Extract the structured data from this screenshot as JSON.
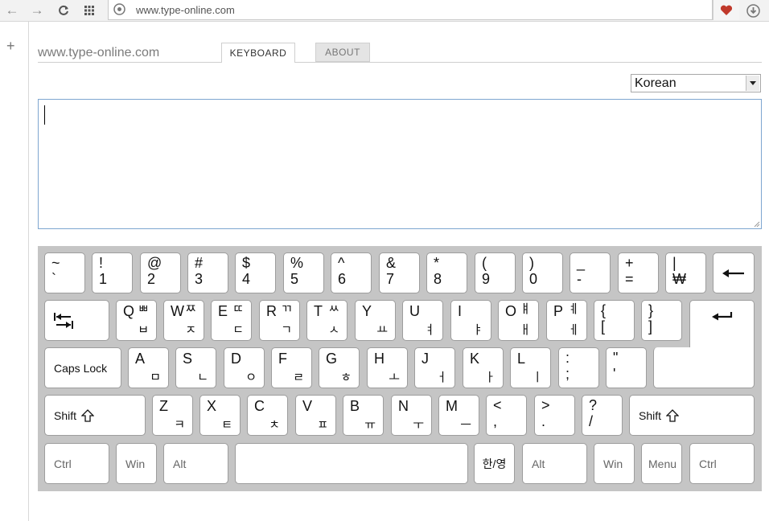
{
  "browser": {
    "url": "www.type-online.com"
  },
  "site": {
    "title": "www.type-online.com"
  },
  "tabs": {
    "keyboard": "KEYBOARD",
    "about": "ABOUT"
  },
  "language": {
    "selected": "Korean"
  },
  "editor": {
    "value": ""
  },
  "keyboard": {
    "row1": [
      {
        "upper": "~",
        "lower": "`"
      },
      {
        "upper": "!",
        "lower": "1"
      },
      {
        "upper": "@",
        "lower": "2"
      },
      {
        "upper": "#",
        "lower": "3"
      },
      {
        "upper": "$",
        "lower": "4"
      },
      {
        "upper": "%",
        "lower": "5"
      },
      {
        "upper": "^",
        "lower": "6"
      },
      {
        "upper": "&",
        "lower": "7"
      },
      {
        "upper": "*",
        "lower": "8"
      },
      {
        "upper": "(",
        "lower": "9"
      },
      {
        "upper": ")",
        "lower": "0"
      },
      {
        "upper": "_",
        "lower": "-"
      },
      {
        "upper": "+",
        "lower": "="
      },
      {
        "upper": "|",
        "lower": "₩"
      }
    ],
    "row2": [
      {
        "en": "Q",
        "ku": "ㅃ",
        "kl": "ㅂ"
      },
      {
        "en": "W",
        "ku": "ㅉ",
        "kl": "ㅈ"
      },
      {
        "en": "E",
        "ku": "ㄸ",
        "kl": "ㄷ"
      },
      {
        "en": "R",
        "ku": "ㄲ",
        "kl": "ㄱ"
      },
      {
        "en": "T",
        "ku": "ㅆ",
        "kl": "ㅅ"
      },
      {
        "en": "Y",
        "ku": "",
        "kl": "ㅛ"
      },
      {
        "en": "U",
        "ku": "",
        "kl": "ㅕ"
      },
      {
        "en": "I",
        "ku": "",
        "kl": "ㅑ"
      },
      {
        "en": "O",
        "ku": "ㅒ",
        "kl": "ㅐ"
      },
      {
        "en": "P",
        "ku": "ㅖ",
        "kl": "ㅔ"
      },
      {
        "upper": "{",
        "lower": "["
      },
      {
        "upper": "}",
        "lower": "]"
      }
    ],
    "row3": [
      {
        "en": "A",
        "kl": "ㅁ"
      },
      {
        "en": "S",
        "kl": "ㄴ"
      },
      {
        "en": "D",
        "kl": "ㅇ"
      },
      {
        "en": "F",
        "kl": "ㄹ"
      },
      {
        "en": "G",
        "kl": "ㅎ"
      },
      {
        "en": "H",
        "kl": "ㅗ"
      },
      {
        "en": "J",
        "kl": "ㅓ"
      },
      {
        "en": "K",
        "kl": "ㅏ"
      },
      {
        "en": "L",
        "kl": "ㅣ"
      },
      {
        "upper": ":",
        "lower": ";"
      },
      {
        "upper": "\"",
        "lower": "'"
      }
    ],
    "row4": [
      {
        "en": "Z",
        "kl": "ㅋ"
      },
      {
        "en": "X",
        "kl": "ㅌ"
      },
      {
        "en": "C",
        "kl": "ㅊ"
      },
      {
        "en": "V",
        "kl": "ㅍ"
      },
      {
        "en": "B",
        "kl": "ㅠ"
      },
      {
        "en": "N",
        "kl": "ㅜ"
      },
      {
        "en": "M",
        "kl": "ㅡ"
      },
      {
        "upper": "<",
        "lower": ","
      },
      {
        "upper": ">",
        "lower": "."
      },
      {
        "upper": "?",
        "lower": "/"
      }
    ],
    "caps_label": "Caps Lock",
    "shift_label": "Shift",
    "ctrl_label": "Ctrl",
    "win_label": "Win",
    "alt_label": "Alt",
    "hanyoung_label": "한/영",
    "menu_label": "Menu"
  },
  "icons": {
    "back": "arrow-left-icon",
    "forward": "arrow-right-icon",
    "reload": "reload-icon",
    "apps": "apps-grid-icon",
    "site": "globe-icon",
    "favorite": "heart-icon",
    "download": "download-icon",
    "backspace": "backspace-arrow-icon",
    "tab": "tab-icon",
    "enter": "enter-icon",
    "shift": "shift-arrow-icon"
  },
  "colors": {
    "heart": "#c0392b",
    "focus_border": "#7ea6d0",
    "keyboard_bg": "#c5c5c5"
  }
}
